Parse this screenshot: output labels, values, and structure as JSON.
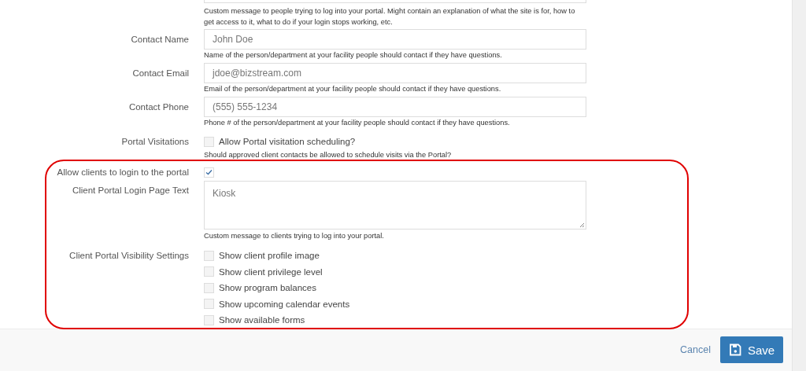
{
  "form": {
    "intro_help": "Custom message to people trying to log into your portal. Might contain an explanation of what the site is for, how to get access to it, what to do if your login stops working, etc.",
    "rows": [
      {
        "kind": "text",
        "label": "Contact Name",
        "value": "John Doe",
        "help": "Name of the person/department at your facility people should contact if they have questions."
      },
      {
        "kind": "text",
        "label": "Contact Email",
        "value": "jdoe@bizstream.com",
        "help": "Email of the person/department at your facility people should contact if they have questions."
      },
      {
        "kind": "text",
        "label": "Contact Phone",
        "value": "(555) 555-1234",
        "help": "Phone # of the person/department at your facility people should contact if they have questions."
      },
      {
        "kind": "checkbox",
        "label": "Portal Visitations",
        "option": "Allow Portal visitation scheduling?",
        "checked": false,
        "help": "Should approved client contacts be allowed to schedule visits via the Portal?"
      },
      {
        "kind": "checkbox",
        "label": "Allow clients to login to the portal",
        "checked": true
      },
      {
        "kind": "textarea",
        "label": "Client Portal Login Page Text",
        "value": "Kiosk",
        "help": "Custom message to clients trying to log into your portal."
      },
      {
        "kind": "checklist",
        "label": "Client Portal Visibility Settings",
        "options": [
          {
            "label": "Show client profile image",
            "checked": false
          },
          {
            "label": "Show client privilege level",
            "checked": false
          },
          {
            "label": "Show program balances",
            "checked": false
          },
          {
            "label": "Show upcoming calendar events",
            "checked": false
          },
          {
            "label": "Show available forms",
            "checked": false
          }
        ]
      }
    ]
  },
  "footer": {
    "cancel": "Cancel",
    "save": "Save"
  }
}
